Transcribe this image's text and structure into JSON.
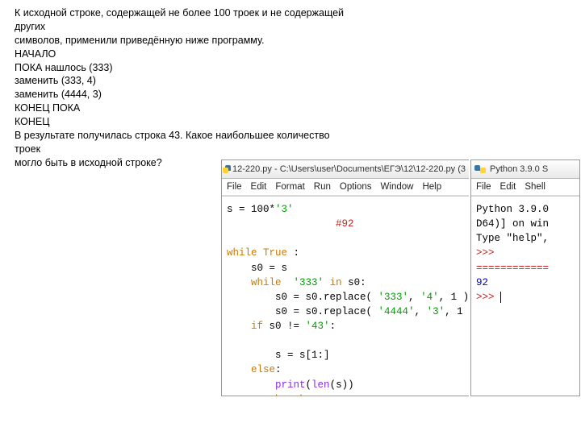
{
  "problem": {
    "l1": "К исходной строке, содержащей не более 100 троек и не содержащей других",
    "l2": "символов, применили приведённую ниже программу.",
    "l3": "НАЧАЛО",
    "l4": "ПОКА нашлось (333)",
    "l5": "  заменить (333, 4)",
    "l6": "  заменить (4444, 3)",
    "l7": "КОНЕЦ ПОКА",
    "l8": "КОНЕЦ",
    "l9": "В результате получилась строка 43. Какое наибольшее количество троек",
    "l10": "могло быть в исходной строке?"
  },
  "editor": {
    "title": "12-220.py - C:\\Users\\user\\Documents\\ЕГЭ\\12\\12-220.py (3",
    "menu": [
      "File",
      "Edit",
      "Format",
      "Run",
      "Options",
      "Window",
      "Help"
    ],
    "code": {
      "c1a": "s = ",
      "c1b": "100",
      "c1c": "*",
      "c1d": "'3'",
      "c2": "                  #92",
      "c3": "while",
      "c3b": " True",
      "c3c": " :",
      "c4": "    s0 = s",
      "c5a": "    ",
      "c5b": "while",
      "c5c": "  ",
      "c5d": "'333'",
      "c5e": " in",
      "c5f": " s0:",
      "c6a": "        s0 = s0.replace( ",
      "c6b": "'333'",
      "c6c": ", ",
      "c6d": "'4'",
      "c6e": ", ",
      "c6f": "1",
      "c6g": " )",
      "c7a": "        s0 = s0.replace( ",
      "c7b": "'4444'",
      "c7c": ", ",
      "c7d": "'3'",
      "c7e": ", ",
      "c7f": "1",
      "c7g": " )",
      "c8a": "    ",
      "c8b": "if",
      "c8c": " s0 != ",
      "c8d": "'43'",
      "c8e": ":",
      "c9": "",
      "c10": "        s = s[",
      "c10b": "1",
      "c10c": ":]",
      "c11a": "    ",
      "c11b": "else",
      "c11c": ":",
      "c12a": "        ",
      "c12b": "print",
      "c12c": "(",
      "c12d": "len",
      "c12e": "(s))",
      "c13a": "        ",
      "c13b": "break"
    }
  },
  "shell": {
    "title": "Python 3.9.0 S",
    "menu": [
      "File",
      "Edit",
      "Shell"
    ],
    "banner1": "Python 3.9.0",
    "banner2": "D64)] on win",
    "banner3": "Type \"help\",",
    "prompt1": ">>> ",
    "divider": "============",
    "result": "92",
    "prompt2": ">>> "
  }
}
